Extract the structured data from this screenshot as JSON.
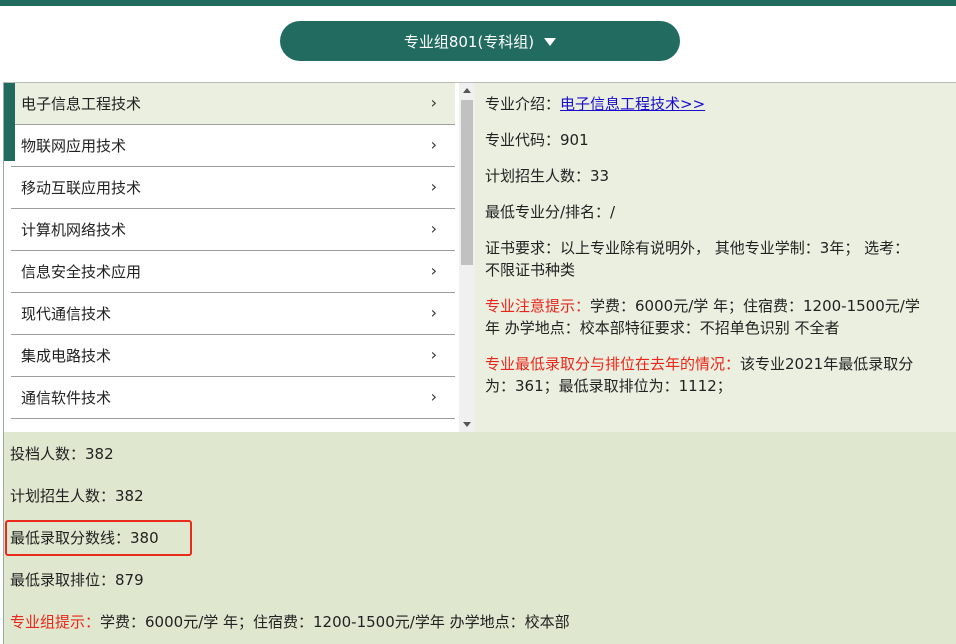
{
  "header": {
    "group_label": "专业组801(专科组)"
  },
  "majors": [
    {
      "label": "电子信息工程技术",
      "chevron": "›"
    },
    {
      "label": "物联网应用技术",
      "chevron": "›"
    },
    {
      "label": "移动互联应用技术",
      "chevron": "›"
    },
    {
      "label": "计算机网络技术",
      "chevron": "›"
    },
    {
      "label": "信息安全技术应用",
      "chevron": "›"
    },
    {
      "label": "现代通信技术",
      "chevron": "›"
    },
    {
      "label": "集成电路技术",
      "chevron": "›"
    },
    {
      "label": "通信软件技术",
      "chevron": "›"
    }
  ],
  "detail": {
    "intro_label": "专业介绍：",
    "intro_link": "电子信息工程技术>>",
    "code": "专业代码：901",
    "plan": "计划招生人数：33",
    "min_score": "最低专业分/排名：/",
    "cert_line1": "证书要求：以上专业除有说明外， 其他专业学制：3年； 选考：",
    "cert_line2": "不限证书种类",
    "notice_label": "专业注意提示：",
    "notice_line1": "学费：6000元/学 年；住宿费：1200-1500元/学",
    "notice_line2": "年 办学地点：校本部特征要求：不招单色识别 不全者",
    "history_label": "专业最低录取分与排位在去年的情况：",
    "history_line1": "该专业2021年最低录取分",
    "history_line2": "为：361；最低录取排位为：1112；"
  },
  "group_stats": {
    "submitted": "投档人数：382",
    "planned": "计划招生人数：382",
    "min_score_line": "最低录取分数线：380",
    "min_rank": "最低录取排位：879",
    "hint_label": "专业组提示：",
    "hint_text": "学费：6000元/学 年；住宿费：1200-1500元/学年 办学地点：校本部"
  }
}
